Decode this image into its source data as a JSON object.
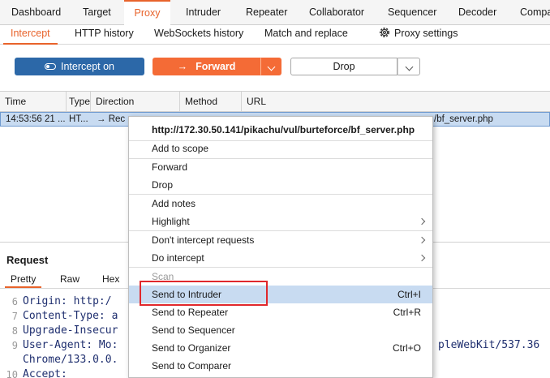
{
  "main_tabs": [
    "Dashboard",
    "Target",
    "Proxy",
    "Intruder",
    "Repeater",
    "Collaborator",
    "Sequencer",
    "Decoder",
    "Compa"
  ],
  "active_main_tab": "Proxy",
  "sub_tabs": [
    "Intercept",
    "HTTP history",
    "WebSockets history",
    "Match and replace"
  ],
  "proxy_settings_label": "Proxy settings",
  "toolbar": {
    "intercept_label": "Intercept on",
    "forward_label": "Forward",
    "drop_label": "Drop"
  },
  "table": {
    "columns": [
      "Time",
      "Type",
      "Direction",
      "Method",
      "URL"
    ],
    "row": {
      "time": "14:53:56 21 ...",
      "type": "HT...",
      "direction": "→  Rec",
      "url_tail": "/bf_server.php"
    }
  },
  "request": {
    "title": "Request",
    "tabs": [
      "Pretty",
      "Raw",
      "Hex"
    ],
    "lines": [
      {
        "n": "6",
        "text": "Origin: http:/"
      },
      {
        "n": "7",
        "text": "Content-Type: a"
      },
      {
        "n": "8",
        "text": "Upgrade-Insecur"
      },
      {
        "n": "9",
        "text": "User-Agent: Mo:"
      },
      {
        "n": "",
        "text": "Chrome/133.0.0."
      },
      {
        "n": "10",
        "text": "Accept:"
      }
    ],
    "user_agent_tail": "pleWebKit/537.36"
  },
  "context_menu": {
    "url": "http://172.30.50.141/pikachu/vul/burteforce/bf_server.php",
    "items": {
      "add_to_scope": "Add to scope",
      "forward": "Forward",
      "drop": "Drop",
      "add_notes": "Add notes",
      "highlight": "Highlight",
      "dont_intercept": "Don't intercept requests",
      "do_intercept": "Do intercept",
      "scan": "Scan",
      "send_intruder": "Send to Intruder",
      "send_intruder_sc": "Ctrl+I",
      "send_repeater": "Send to Repeater",
      "send_repeater_sc": "Ctrl+R",
      "send_sequencer": "Send to Sequencer",
      "send_organizer": "Send to Organizer",
      "send_organizer_sc": "Ctrl+O",
      "send_comparer": "Send to Comparer"
    }
  },
  "colors": {
    "accent": "#e8632b",
    "intercept_button": "#2c68a8",
    "forward_button": "#f46b36",
    "selection": "#c8dbf1",
    "annotation_box": "#e0282c"
  }
}
